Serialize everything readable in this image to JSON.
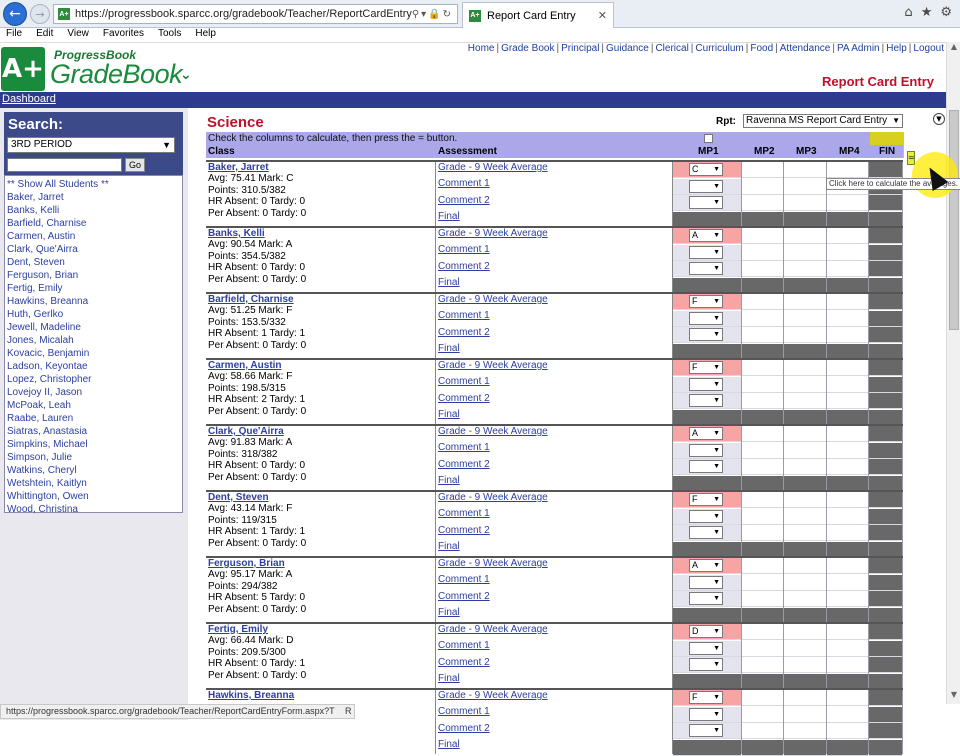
{
  "browser": {
    "url": "https://progressbook.sparcc.org/gradebook/Teacher/ReportCardEntryForm.aspx?",
    "tab_title": "Report Card Entry",
    "menu": [
      "File",
      "Edit",
      "View",
      "Favorites",
      "Tools",
      "Help"
    ],
    "status_url": "https://progressbook.sparcc.org/gradebook/Teacher/ReportCardEntryForm.aspx?T",
    "status_suffix": "R"
  },
  "header": {
    "logo_mark": "A+",
    "logo_small": "ProgressBook",
    "logo_big": "GradeBook",
    "links": [
      "Home",
      "Grade Book",
      "Principal",
      "Guidance",
      "Clerical",
      "Curriculum",
      "Food",
      "Attendance",
      "PA Admin",
      "Help",
      "Logout"
    ],
    "page_title": "Report Card Entry",
    "breadcrumb": "Dashboard"
  },
  "sidebar": {
    "title": "Search:",
    "period": "3RD PERIOD",
    "go_label": "Go",
    "show_all": "** Show All Students **",
    "students": [
      "Baker, Jarret",
      "Banks, Kelli",
      "Barfield, Charnise",
      "Carmen, Austin",
      "Clark, Que'Airra",
      "Dent, Steven",
      "Ferguson, Brian",
      "Fertig, Emily",
      "Hawkins, Breanna",
      "Huth, Gerlko",
      "Jewell, Madeline",
      "Jones, Micalah",
      "Kovacic, Benjamin",
      "Ladson, Keyontae",
      "Lopez, Christopher",
      "Lovejoy II, Jason",
      "McPoak, Leah",
      "Raabe, Lauren",
      "Siatras, Anastasia",
      "Simpkins, Michael",
      "Simpson, Julie",
      "Watkins, Cheryl",
      "Wetshtein, Kaitlyn",
      "Whittington, Owen",
      "Wood, Christina"
    ]
  },
  "main": {
    "subject": "Science",
    "rpt_label": "Rpt:",
    "rpt_value": "Ravenna MS Report Card Entry",
    "instructions": "Check the columns to calculate, then press the = button.",
    "calc_symbol": "=",
    "tooltip": "Click here to calculate the averages.",
    "columns": {
      "class": "Class",
      "assessment": "Assessment",
      "mp1": "MP1",
      "mp2": "MP2",
      "mp3": "MP3",
      "mp4": "MP4",
      "fin": "FIN"
    },
    "assessment_labels": {
      "grade": "Grade - 9 Week Average",
      "comment1": "Comment 1",
      "comment2": "Comment 2",
      "final": "Final"
    },
    "rows": [
      {
        "name": "Baker, Jarret",
        "avg": "Avg: 75.41 Mark: C",
        "points": "Points: 310.5/382",
        "hr": "HR Absent: 0 Tardy: 0",
        "per": "Per Absent: 0 Tardy: 0",
        "grade": "C"
      },
      {
        "name": "Banks, Kelli",
        "avg": "Avg: 90.54 Mark: A",
        "points": "Points: 354.5/382",
        "hr": "HR Absent: 0 Tardy: 0",
        "per": "Per Absent: 0 Tardy: 0",
        "grade": "A"
      },
      {
        "name": "Barfield, Charnise",
        "avg": "Avg: 51.25 Mark: F",
        "points": "Points: 153.5/332",
        "hr": "HR Absent: 1 Tardy: 1",
        "per": "Per Absent: 0 Tardy: 0",
        "grade": "F"
      },
      {
        "name": "Carmen, Austin",
        "avg": "Avg: 58.66 Mark: F",
        "points": "Points: 198.5/315",
        "hr": "HR Absent: 2 Tardy: 1",
        "per": "Per Absent: 0 Tardy: 0",
        "grade": "F"
      },
      {
        "name": "Clark, Que'Airra",
        "avg": "Avg: 91.83 Mark: A",
        "points": "Points: 318/382",
        "hr": "HR Absent: 0 Tardy: 0",
        "per": "Per Absent: 0 Tardy: 0",
        "grade": "A"
      },
      {
        "name": "Dent, Steven",
        "avg": "Avg: 43.14 Mark: F",
        "points": "Points: 119/315",
        "hr": "HR Absent: 1 Tardy: 1",
        "per": "Per Absent: 0 Tardy: 0",
        "grade": "F"
      },
      {
        "name": "Ferguson, Brian",
        "avg": "Avg: 95.17 Mark: A",
        "points": "Points: 294/382",
        "hr": "HR Absent: 5 Tardy: 0",
        "per": "Per Absent: 0 Tardy: 0",
        "grade": "A"
      },
      {
        "name": "Fertig, Emily",
        "avg": "Avg: 66.44 Mark: D",
        "points": "Points: 209.5/300",
        "hr": "HR Absent: 0 Tardy: 1",
        "per": "Per Absent: 0 Tardy: 0",
        "grade": "D"
      },
      {
        "name": "Hawkins, Breanna",
        "avg": "",
        "points": "",
        "hr": "",
        "per": "",
        "grade": "F"
      }
    ]
  },
  "colors": {
    "accent_red": "#c0102a",
    "nav_blue": "#2d3b8e",
    "brand_green": "#1a8a3c",
    "grade_cell": "#f6a4a4",
    "header_lavender": "#aaa8e8"
  }
}
